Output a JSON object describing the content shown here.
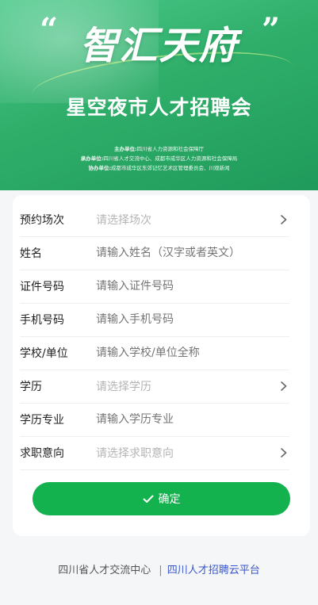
{
  "banner": {
    "title": "智汇天府",
    "quote_open": "“",
    "quote_close": "”",
    "subtitle": "星空夜市人才招聘会",
    "organizer_label": "主办单位:",
    "organizer": "四川省人力资源和社会保障厅",
    "undertaker_label": "承办单位:",
    "undertaker": "四川省人才交流中心、成都市成华区人力资源和社会保障局",
    "co_organizer_label": "协办单位:",
    "co_organizer": "成都市成华区东郊记忆艺术区管理委员会、川观新闻"
  },
  "form": {
    "rows": [
      {
        "label": "预约场次",
        "placeholder": "请选择场次",
        "type": "select"
      },
      {
        "label": "姓名",
        "placeholder": "请输入姓名（汉字或者英文）",
        "type": "input"
      },
      {
        "label": "证件号码",
        "placeholder": "请输入证件号码",
        "type": "input"
      },
      {
        "label": "手机号码",
        "placeholder": "请输入手机号码",
        "type": "input"
      },
      {
        "label": "学校/单位",
        "placeholder": "请输入学校/单位全称",
        "type": "input"
      },
      {
        "label": "学历",
        "placeholder": "请选择学历",
        "type": "select"
      },
      {
        "label": "学历专业",
        "placeholder": "请输入学历专业",
        "type": "input"
      },
      {
        "label": "求职意向",
        "placeholder": "请选择求职意向",
        "type": "select"
      }
    ],
    "submit_label": "确定"
  },
  "footer": {
    "org": "四川省人才交流中心",
    "separator": "|",
    "platform": "四川人才招聘云平台"
  },
  "colors": {
    "accent": "#14b14f",
    "banner": "#2fae6a",
    "link": "#3a57c9"
  },
  "icons": {
    "chevron": "chevron-right-icon",
    "check": "check-icon"
  }
}
